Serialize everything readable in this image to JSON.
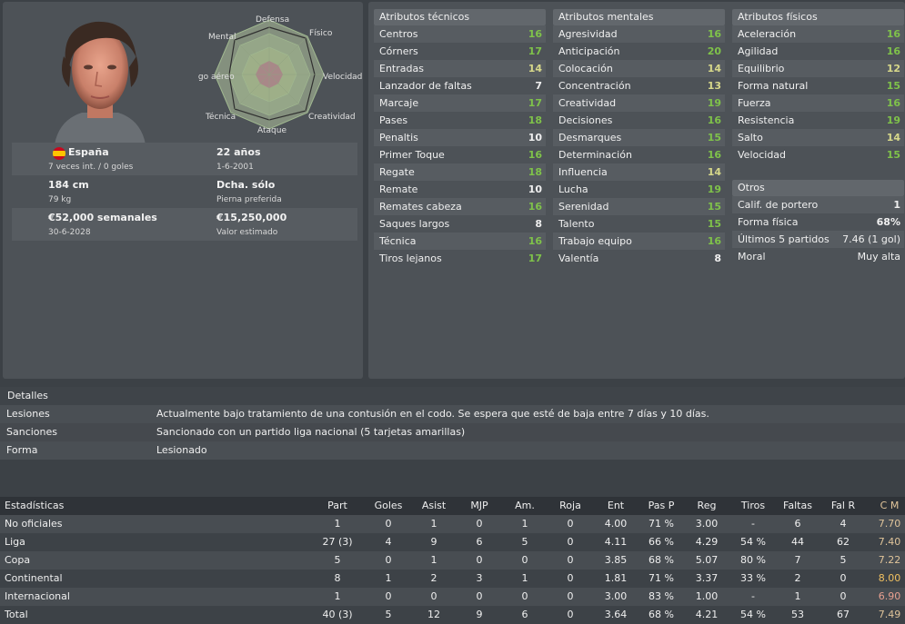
{
  "colors": {
    "attr_high": "#7fc24a",
    "attr_mid": "#d7d88a",
    "attr_low": "#efefef",
    "cm_value": "#e0c49a"
  },
  "profile": {
    "radar_labels": {
      "top": "Defensa",
      "top_right": "Físico",
      "right": "Velocidad",
      "bottom_right": "Creatividad",
      "bottom": "Ataque",
      "bottom_left": "Técnica",
      "left": "Juego aéreo",
      "top_left": "Mental"
    },
    "nationality": "España",
    "caps": "7 veces int. / 0 goles",
    "age": "22 años",
    "dob": "1-6-2001",
    "height": "184 cm",
    "weight": "79 kg",
    "foot": "Dcha. sólo",
    "foot_label": "Pierna preferida",
    "wage": "€52,000 semanales",
    "contract": "30-6-2028",
    "value": "€15,250,000",
    "value_label": "Valor estimado"
  },
  "tecnicos": {
    "title": "Atributos técnicos",
    "items": [
      {
        "label": "Centros",
        "value": "16"
      },
      {
        "label": "Córners",
        "value": "17"
      },
      {
        "label": "Entradas",
        "value": "14"
      },
      {
        "label": "Lanzador de faltas",
        "value": "7"
      },
      {
        "label": "Marcaje",
        "value": "17"
      },
      {
        "label": "Pases",
        "value": "18"
      },
      {
        "label": "Penaltis",
        "value": "10"
      },
      {
        "label": "Primer Toque",
        "value": "16"
      },
      {
        "label": "Regate",
        "value": "18"
      },
      {
        "label": "Remate",
        "value": "10"
      },
      {
        "label": "Remates cabeza",
        "value": "16"
      },
      {
        "label": "Saques largos",
        "value": "8"
      },
      {
        "label": "Técnica",
        "value": "16"
      },
      {
        "label": "Tiros lejanos",
        "value": "17"
      }
    ]
  },
  "mentales": {
    "title": "Atributos mentales",
    "items": [
      {
        "label": "Agresividad",
        "value": "16"
      },
      {
        "label": "Anticipación",
        "value": "20"
      },
      {
        "label": "Colocación",
        "value": "14"
      },
      {
        "label": "Concentración",
        "value": "13"
      },
      {
        "label": "Creatividad",
        "value": "19"
      },
      {
        "label": "Decisiones",
        "value": "16"
      },
      {
        "label": "Desmarques",
        "value": "15"
      },
      {
        "label": "Determinación",
        "value": "16"
      },
      {
        "label": "Influencia",
        "value": "14"
      },
      {
        "label": "Lucha",
        "value": "19"
      },
      {
        "label": "Serenidad",
        "value": "15"
      },
      {
        "label": "Talento",
        "value": "15"
      },
      {
        "label": "Trabajo equipo",
        "value": "16"
      },
      {
        "label": "Valentía",
        "value": "8"
      }
    ]
  },
  "fisicos": {
    "title": "Atributos físicos",
    "items": [
      {
        "label": "Aceleración",
        "value": "16"
      },
      {
        "label": "Agilidad",
        "value": "16"
      },
      {
        "label": "Equilibrio",
        "value": "12"
      },
      {
        "label": "Forma natural",
        "value": "15"
      },
      {
        "label": "Fuerza",
        "value": "16"
      },
      {
        "label": "Resistencia",
        "value": "19"
      },
      {
        "label": "Salto",
        "value": "14"
      },
      {
        "label": "Velocidad",
        "value": "15"
      }
    ]
  },
  "otros": {
    "title": "Otros",
    "items": [
      {
        "label": "Calif. de portero",
        "value": "1"
      },
      {
        "label": "Forma física",
        "value": "68%"
      },
      {
        "label": "Últimos 5 partidos",
        "value": "7.46 (1 gol)"
      },
      {
        "label": "Moral",
        "value": "Muy alta"
      }
    ]
  },
  "detalles": {
    "title": "Detalles",
    "rows": [
      {
        "label": "Lesiones",
        "text": "Actualmente bajo tratamiento de una contusión en el codo. Se espera que esté de baja entre 7 días y 10 días."
      },
      {
        "label": "Sanciones",
        "text": "Sancionado con un partido liga nacional (5 tarjetas amarillas)"
      },
      {
        "label": "Forma",
        "text": "Lesionado"
      }
    ]
  },
  "stats": {
    "headers": [
      "Estadísticas",
      "Part",
      "Goles",
      "Asist",
      "MJP",
      "Am.",
      "Roja",
      "Ent",
      "Pas P",
      "Reg",
      "Tiros",
      "Faltas",
      "Fal R",
      "C M"
    ],
    "rows": [
      [
        "No oficiales",
        "1",
        "0",
        "1",
        "0",
        "1",
        "0",
        "4.00",
        "71 %",
        "3.00",
        "-",
        "6",
        "4",
        "7.70"
      ],
      [
        "Liga",
        "27 (3)",
        "4",
        "9",
        "6",
        "5",
        "0",
        "4.11",
        "66 %",
        "4.29",
        "54 %",
        "44",
        "62",
        "7.40"
      ],
      [
        "Copa",
        "5",
        "0",
        "1",
        "0",
        "0",
        "0",
        "3.85",
        "68 %",
        "5.07",
        "80 %",
        "7",
        "5",
        "7.22"
      ],
      [
        "Continental",
        "8",
        "1",
        "2",
        "3",
        "1",
        "0",
        "1.81",
        "71 %",
        "3.37",
        "33 %",
        "2",
        "0",
        "8.00"
      ],
      [
        "Internacional",
        "1",
        "0",
        "0",
        "0",
        "0",
        "0",
        "3.00",
        "83 %",
        "1.00",
        "-",
        "1",
        "0",
        "6.90"
      ],
      [
        "Total",
        "40 (3)",
        "5",
        "12",
        "9",
        "6",
        "0",
        "3.64",
        "68 %",
        "4.21",
        "54 %",
        "53",
        "67",
        "7.49"
      ]
    ]
  }
}
